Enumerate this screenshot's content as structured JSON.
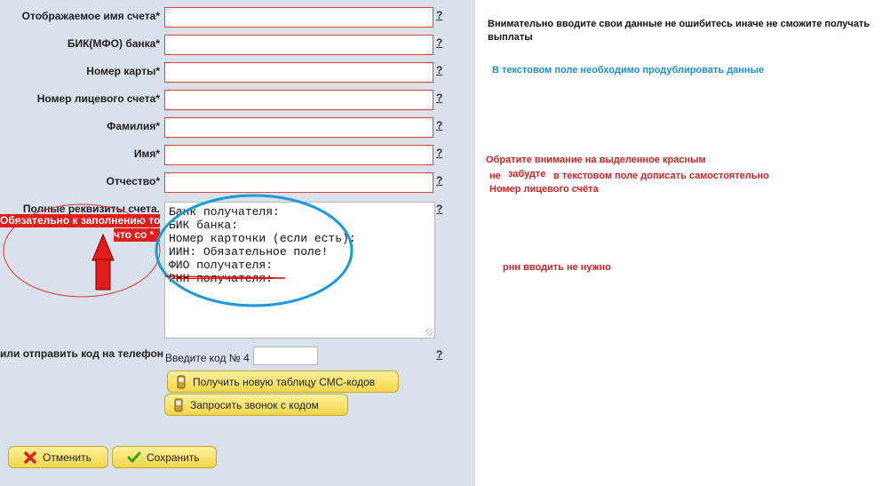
{
  "form": {
    "fields": [
      {
        "label": "Отображаемое имя счета*",
        "value": "",
        "help": "?"
      },
      {
        "label": "БИК(МФО) банка*",
        "value": "",
        "help": "?"
      },
      {
        "label": "Номер карты*",
        "value": "",
        "help": "?"
      },
      {
        "label": "Номер лицевого счета*",
        "value": "",
        "help": "?"
      },
      {
        "label": "Фамилия*",
        "value": "",
        "help": "?"
      },
      {
        "label": "Имя*",
        "value": "",
        "help": "?"
      },
      {
        "label": "Отчество*",
        "value": "",
        "help": "?"
      }
    ],
    "details": {
      "label": "Полные реквизиты счета.",
      "help": "?",
      "lines": [
        "Банк получателя:",
        "БИК банка:",
        "Номер карточки (если есть):",
        "ИИН: Обязательное поле!",
        "ФИО получателя:",
        "РНН получателя:"
      ]
    },
    "sms": {
      "label": "или отправить код на телефон",
      "prompt": "Введите код № 4",
      "value": "",
      "help": "?"
    },
    "buttons": {
      "new_table": "Получить новую таблицу СМС-кодов",
      "request_call": "Запросить звонок с кодом",
      "cancel": "Отменить",
      "save": "Сохранить"
    }
  },
  "annotations": {
    "required_bar_1": "Обязательно к заполнению то,",
    "required_bar_2": "что со *",
    "note_careful": "Внимательно вводите свои данные не ошибитесь иначе не сможите получать выплаты",
    "note_duplicate": "В текстовом поле необходимо продублировать данные",
    "note_attention_1": "Обратите внимание на выделенное красным",
    "note_attention_2a": "не",
    "note_attention_2b": "забудте",
    "note_attention_2c": "в текстовом поле дописать самостоятельно",
    "note_attention_3": "Номер лицевого счёта",
    "note_rnn": "рнн вводить не нужно",
    "colors": {
      "red": "#d32020",
      "blue": "#1a8fc9",
      "panel": "#d9e1ec",
      "button": "#f3d64b"
    }
  }
}
